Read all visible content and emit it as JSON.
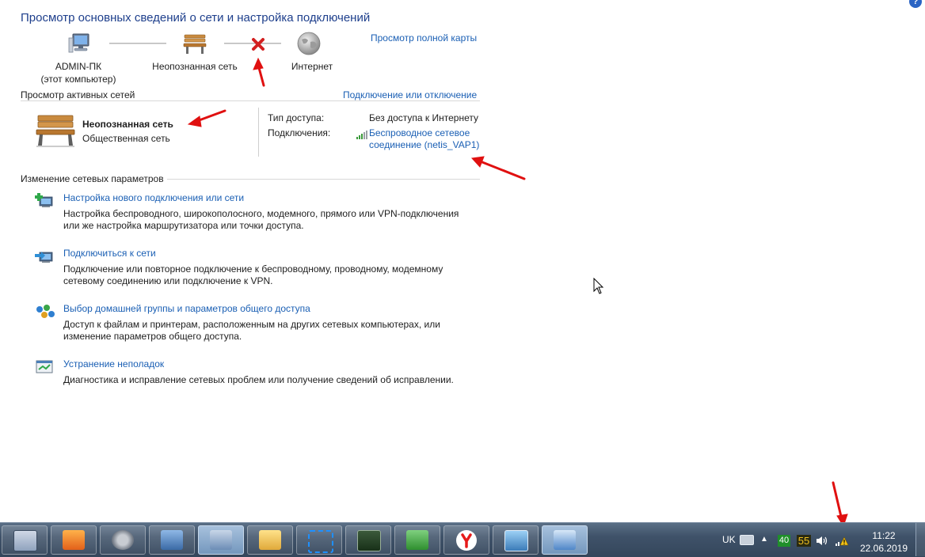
{
  "header": {
    "title": "Просмотр основных сведений о сети и настройка подключений",
    "help_label": "?",
    "full_map_link": "Просмотр полной карты"
  },
  "network_map": {
    "computer_name": "ADMIN-ПК",
    "computer_sub": "(этот компьютер)",
    "network_name": "Неопознанная сеть",
    "internet_label": "Интернет"
  },
  "active_networks": {
    "section_label": "Просмотр активных сетей",
    "connect_link": "Подключение или отключение",
    "network_name": "Неопознанная сеть",
    "network_type": "Общественная сеть",
    "access_type_label": "Тип доступа:",
    "access_type_value": "Без доступа к Интернету",
    "connections_label": "Подключения:",
    "connection_link_line1": "Беспроводное сетевое",
    "connection_link_line2": "соединение (netis_VAP1)"
  },
  "change_settings": {
    "section_label": "Изменение сетевых параметров",
    "tasks": [
      {
        "title": "Настройка нового подключения или сети",
        "desc1": "Настройка беспроводного, широкополосного, модемного, прямого или VPN-подключения",
        "desc2": "или же настройка маршрутизатора или точки доступа."
      },
      {
        "title": "Подключиться к сети",
        "desc1": "Подключение или повторное подключение к беспроводному, проводному, модемному",
        "desc2": "сетевому соединению или подключение к VPN."
      },
      {
        "title": "Выбор домашней группы и параметров общего доступа",
        "desc1": "Доступ к файлам и принтерам, расположенным на других сетевых компьютерах, или",
        "desc2": "изменение параметров общего доступа."
      },
      {
        "title": "Устранение неполадок",
        "desc1": "Диагностика и исправление сетевых проблем или получение сведений об исправлении.",
        "desc2": ""
      }
    ]
  },
  "taskbar": {
    "language": "UK",
    "tray_badge_1": "40",
    "tray_badge_2": "55",
    "time": "11:22",
    "date": "22.06.2019"
  },
  "colors": {
    "link": "#1a5fb4",
    "title": "#1e3f8c",
    "arrow": "#e01010",
    "error_x": "#d21f1f"
  }
}
